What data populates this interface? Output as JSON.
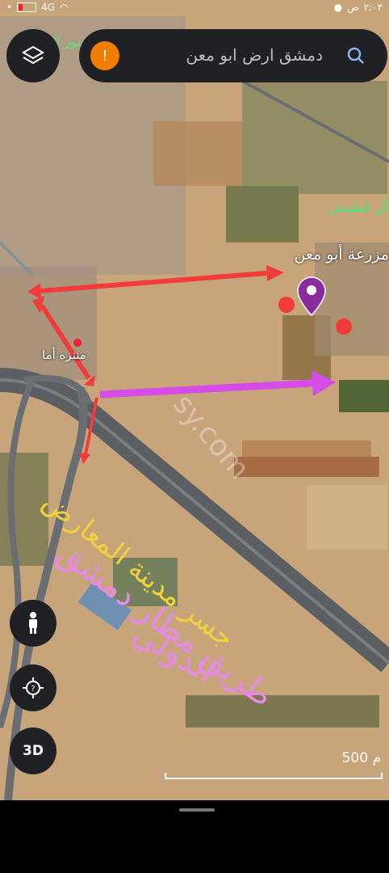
{
  "status": {
    "time": "٢:٠٣",
    "ampm": "ص",
    "network": "4G"
  },
  "search": {
    "text": "دمشق ارض ابو معن",
    "avatar_letter": "!"
  },
  "map_labels": {
    "farm": "مزرعة أبو معن",
    "al_qatish": "آل قطيش",
    "park": "منتزه أما",
    "exhibition": "جسر مدينة المعارض",
    "airport_road_1": "طريق مطار دمشق",
    "airport_road_2": "الدولي",
    "watermark": "sy.com",
    "top_label": "سور ال"
  },
  "controls": {
    "btn_3d": "3D"
  },
  "scale": {
    "label": "500 م"
  },
  "colors": {
    "red_arrow": "#f23b3b",
    "magenta_arrow": "#d64ce6",
    "yellow_text": "#f2d23a",
    "pink_text": "#e58ae6",
    "pin": "#8a2c9e",
    "green_label": "#4be07a"
  }
}
